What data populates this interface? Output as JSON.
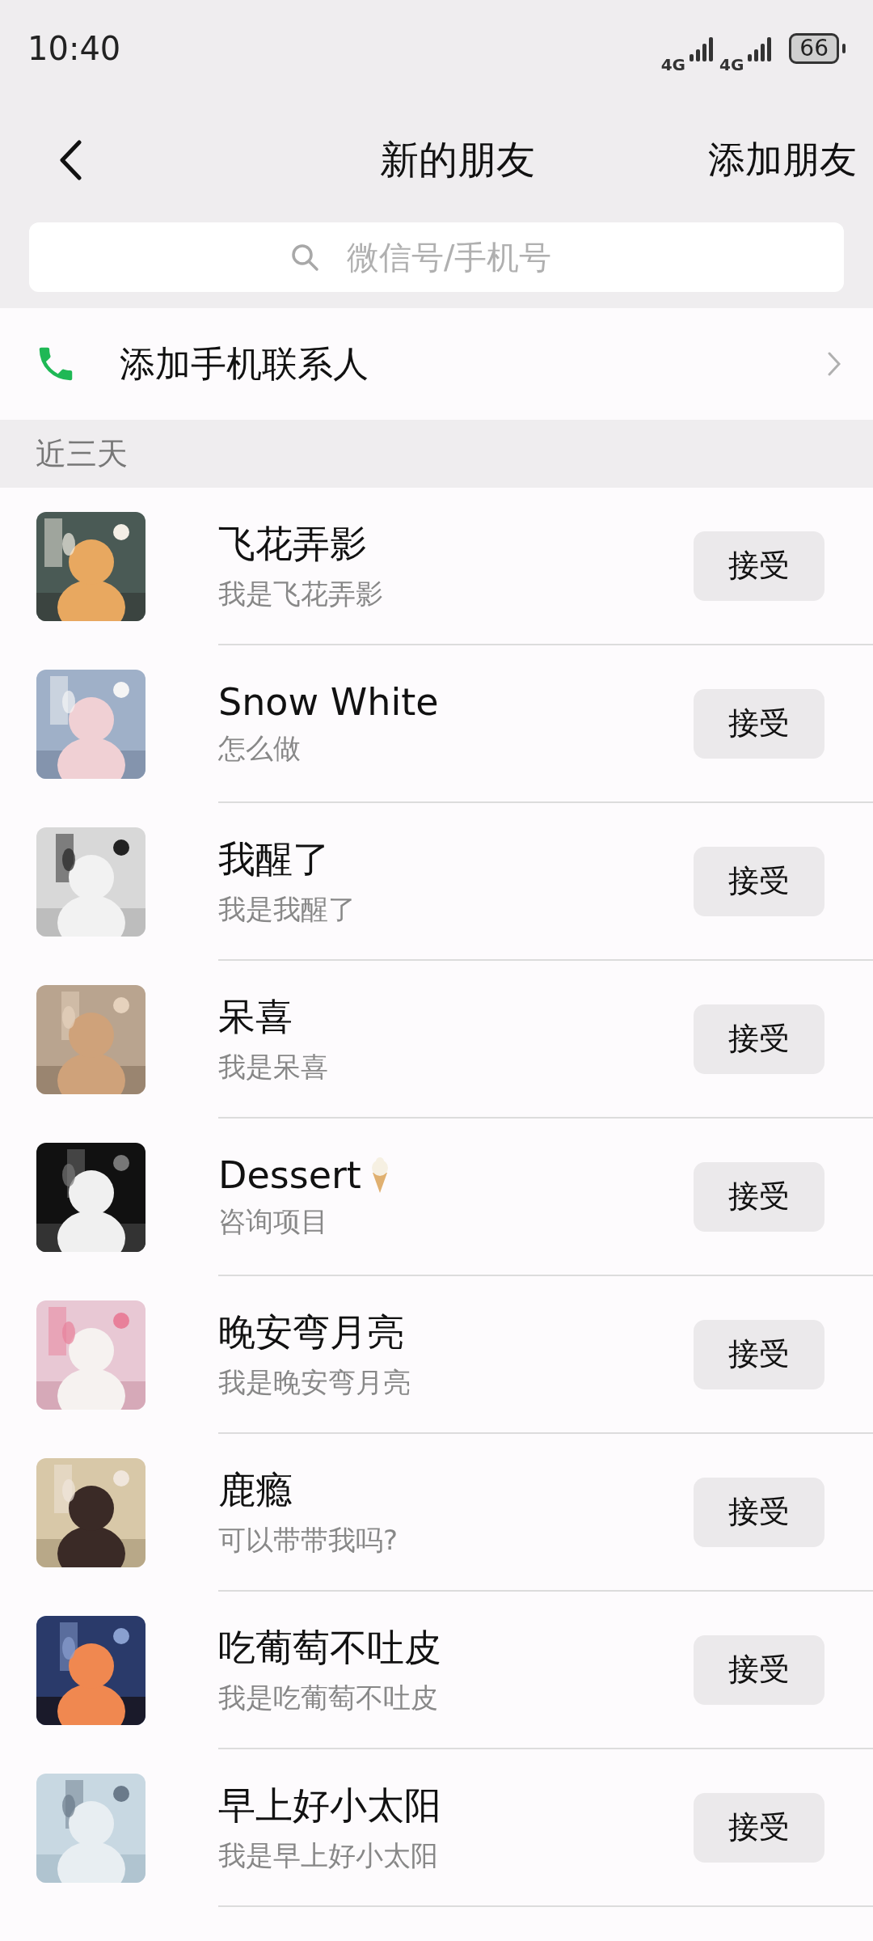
{
  "status_bar": {
    "time": "10:40",
    "battery": "66",
    "network_1": "4G",
    "network_2": "4G"
  },
  "header": {
    "title": "新的朋友",
    "action": "添加朋友"
  },
  "search": {
    "placeholder": "微信号/手机号"
  },
  "add_contacts": {
    "label": "添加手机联系人"
  },
  "section": {
    "title": "近三天"
  },
  "requests": [
    {
      "name": "飞花弄影",
      "message": "我是飞花弄影",
      "button": "接受",
      "has_icon": false
    },
    {
      "name": "Snow White",
      "message": "怎么做",
      "button": "接受",
      "has_icon": false
    },
    {
      "name": "我醒了",
      "message": "我是我醒了",
      "button": "接受",
      "has_icon": false
    },
    {
      "name": "呆喜",
      "message": "我是呆喜",
      "button": "接受",
      "has_icon": false
    },
    {
      "name": "Dessert",
      "message": "咨询项目",
      "button": "接受",
      "has_icon": true
    },
    {
      "name": "晚安弯月亮",
      "message": "我是晚安弯月亮",
      "button": "接受",
      "has_icon": false
    },
    {
      "name": "鹿瘾",
      "message": "可以带带我吗?",
      "button": "接受",
      "has_icon": false
    },
    {
      "name": "吃葡萄不吐皮",
      "message": "我是吃葡萄不吐皮",
      "button": "接受",
      "has_icon": false
    },
    {
      "name": "早上好小太阳",
      "message": "我是早上好小太阳",
      "button": "接受",
      "has_icon": false
    }
  ]
}
